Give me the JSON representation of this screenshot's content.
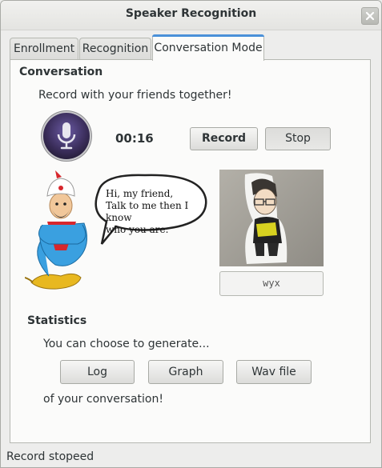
{
  "window": {
    "title": "Speaker Recognition"
  },
  "tabs": [
    {
      "label": "Enrollment"
    },
    {
      "label": "Recognition"
    },
    {
      "label": "Conversation Mode"
    }
  ],
  "conversation": {
    "heading": "Conversation",
    "instruction": "Record with your friends together!",
    "timer": "00:16",
    "record_label": "Record",
    "stop_label": "Stop",
    "bubble_lines": [
      "Hi, my friend,",
      "Talk to me then I know",
      "who you are."
    ],
    "speaker_name": "wyx"
  },
  "statistics": {
    "heading": "Statistics",
    "prompt": "You can choose to generate...",
    "log_label": "Log",
    "graph_label": "Graph",
    "wav_label": "Wav file",
    "suffix": "of your conversation!"
  },
  "status": {
    "text": "Record stopeed"
  },
  "colors": {
    "accent": "#4a90d9",
    "window_bg": "#ededec",
    "panel_bg": "#fbfbfa"
  },
  "icons": {
    "mic": "microphone-icon",
    "close": "close-icon"
  }
}
